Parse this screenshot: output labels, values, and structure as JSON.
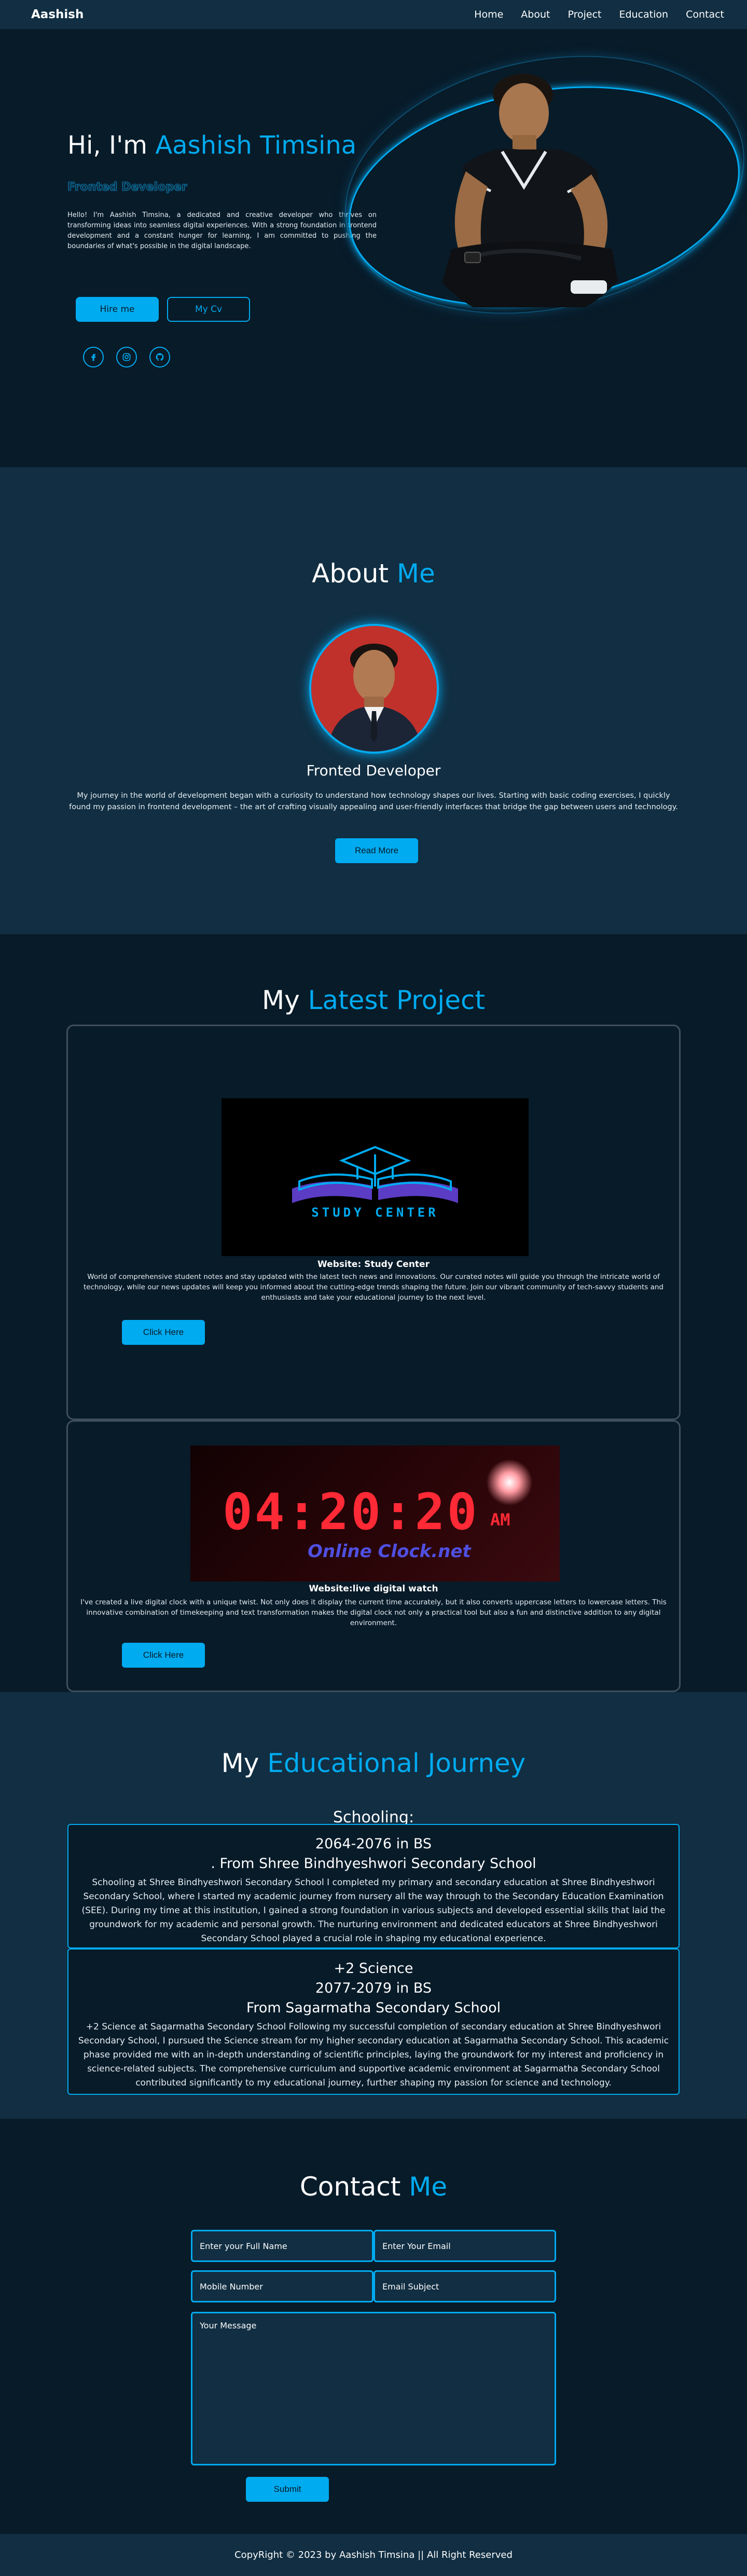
{
  "header": {
    "logo": "Aashish",
    "nav": [
      "Home",
      "About",
      "Project",
      "Education",
      "Contact"
    ]
  },
  "home": {
    "greeting": "Hi, I'm",
    "name": "Aashish Timsina",
    "subtitle": "Fronted Developer",
    "intro": "Hello! I'm Aashish Timsina, a dedicated and creative developer who thrives on transforming ideas into seamless digital experiences. With a strong foundation in frontend development and a constant hunger for learning, I am committed to pushing the boundaries of what's possible in the digital landscape.",
    "hire_label": "Hire me",
    "cv_label": "My Cv",
    "socials": [
      "facebook-icon",
      "instagram-icon",
      "github-icon"
    ]
  },
  "about": {
    "title_main": "About",
    "title_accent": "Me",
    "role": "Fronted Developer",
    "text": "My journey in the world of development began with a curiosity to understand how technology shapes our lives. Starting with basic coding exercises, I quickly found my passion in frontend development – the art of crafting visually appealing and user-friendly interfaces that bridge the gap between users and technology.",
    "button": "Read More"
  },
  "projects": {
    "title_main": "My",
    "title_accent": "Latest Project",
    "items": [
      {
        "logo_text": "STUDY CENTER",
        "title": "Website: Study Center",
        "text": "World of comprehensive student notes and stay updated with the latest tech news and innovations. Our curated notes will guide you through the intricate world of technology, while our news updates will keep you informed about the cutting-edge trends shaping the future. Join our vibrant community of tech-savvy students and enthusiasts and take your educational journey to the next level.",
        "button": "Click Here"
      },
      {
        "clock_time": "04:20:20",
        "clock_ampm": "AM",
        "clock_brand": "Online Clock.net",
        "title": "Website:live digital watch",
        "text": "I've created a live digital clock with a unique twist. Not only does it display the current time accurately, but it also converts uppercase letters to lowercase letters. This innovative combination of timekeeping and text transformation makes the digital clock not only a practical tool but also a fun and distinctive addition to any digital environment.",
        "button": "Click Here"
      }
    ]
  },
  "education": {
    "title_main": "My",
    "title_accent": "Educational Journey",
    "heading": "Schooling:",
    "items": [
      {
        "lines": [
          "2064-2076 in BS",
          ". From Shree Bindhyeshwori Secondary School"
        ],
        "text": "Schooling at Shree Bindhyeshwori Secondary School I completed my primary and secondary education at Shree Bindhyeshwori Secondary School, where I started my academic journey from nursery all the way through to the Secondary Education Examination (SEE). During my time at this institution, I gained a strong foundation in various subjects and developed essential skills that laid the groundwork for my academic and personal growth. The nurturing environment and dedicated educators at Shree Bindhyeshwori Secondary School played a crucial role in shaping my educational experience."
      },
      {
        "lines": [
          "+2 Science",
          "2077-2079 in BS",
          "From Sagarmatha Secondary School"
        ],
        "text": "+2 Science at Sagarmatha Secondary School Following my successful completion of secondary education at Shree Bindhyeshwori Secondary School, I pursued the Science stream for my higher secondary education at Sagarmatha Secondary School. This academic phase provided me with an in-depth understanding of scientific principles, laying the groundwork for my interest and proficiency in science-related subjects. The comprehensive curriculum and supportive academic environment at Sagarmatha Secondary School contributed significantly to my educational journey, further shaping my passion for science and technology."
      }
    ]
  },
  "contact": {
    "title_main": "Contact",
    "title_accent": "Me",
    "name_placeholder": "Enter your Full Name",
    "email_placeholder": "Enter Your Email",
    "phone_placeholder": "Mobile Number",
    "subject_placeholder": "Email Subject",
    "message_placeholder": "Your Message",
    "submit": "Submit"
  },
  "footer": {
    "text": "CopyRight © 2023 by Aashish Timsina || All Right Reserved"
  },
  "colors": {
    "accent": "#00abf0",
    "bg_dark": "#081b29",
    "bg_light": "#112e42"
  }
}
